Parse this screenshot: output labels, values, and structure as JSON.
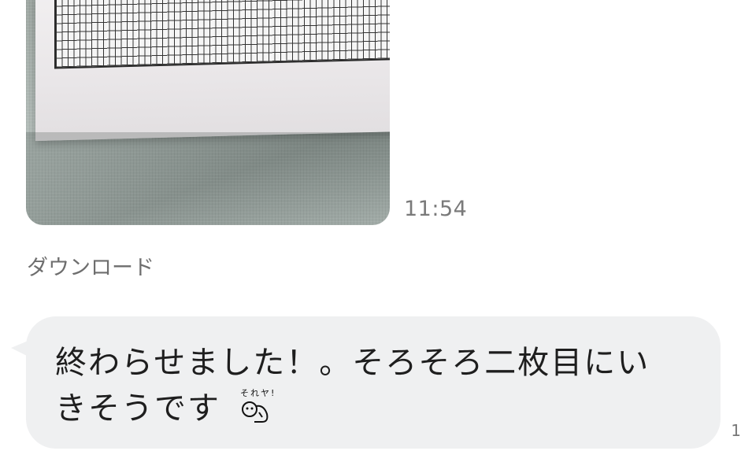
{
  "message_image": {
    "timestamp": "11:54"
  },
  "download": {
    "label": "ダウンロード"
  },
  "message": {
    "line1": "終わらせました！。そろそろ二枚目にい",
    "line2": "きそうです",
    "sticker_text": "それヤ!",
    "sticker_icon": "cartoon-character-emoji"
  },
  "edge": {
    "label": "1"
  },
  "colors": {
    "bubble": "#eff0f1",
    "timestamp": "#7a7a7a",
    "text": "#1e1e1e"
  }
}
